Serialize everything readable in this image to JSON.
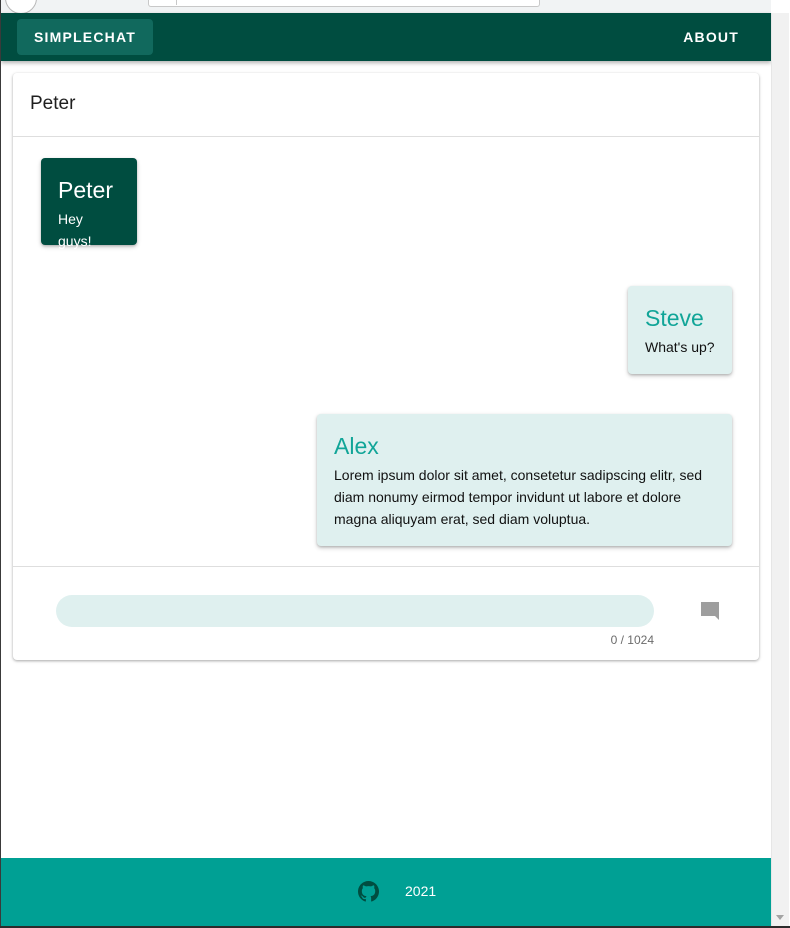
{
  "app_bar": {
    "brand_label": "SIMPLECHAT",
    "about_label": "ABOUT",
    "background_color": "#004d40"
  },
  "chat": {
    "title": "Peter",
    "messages": [
      {
        "author": "Peter",
        "text": "Hey guys!",
        "own": true
      },
      {
        "author": "Steve",
        "text": "What's up?",
        "own": false
      },
      {
        "author": "Alex",
        "text": "Lorem ipsum dolor sit amet, consetetur sadipscing elitr, sed diam nonumy eirmod tempor invidunt ut labore et dolore magna aliquyam erat, sed diam voluptua.",
        "own": false
      }
    ]
  },
  "composer": {
    "value": "",
    "counter": "0 / 1024",
    "send_icon": "message-icon"
  },
  "footer": {
    "icon": "github-icon",
    "year": "2021",
    "background_color": "#00a094"
  },
  "colors": {
    "own_bubble": "#004d40",
    "other_bubble": "#dff0ef",
    "other_author": "#11a598"
  }
}
